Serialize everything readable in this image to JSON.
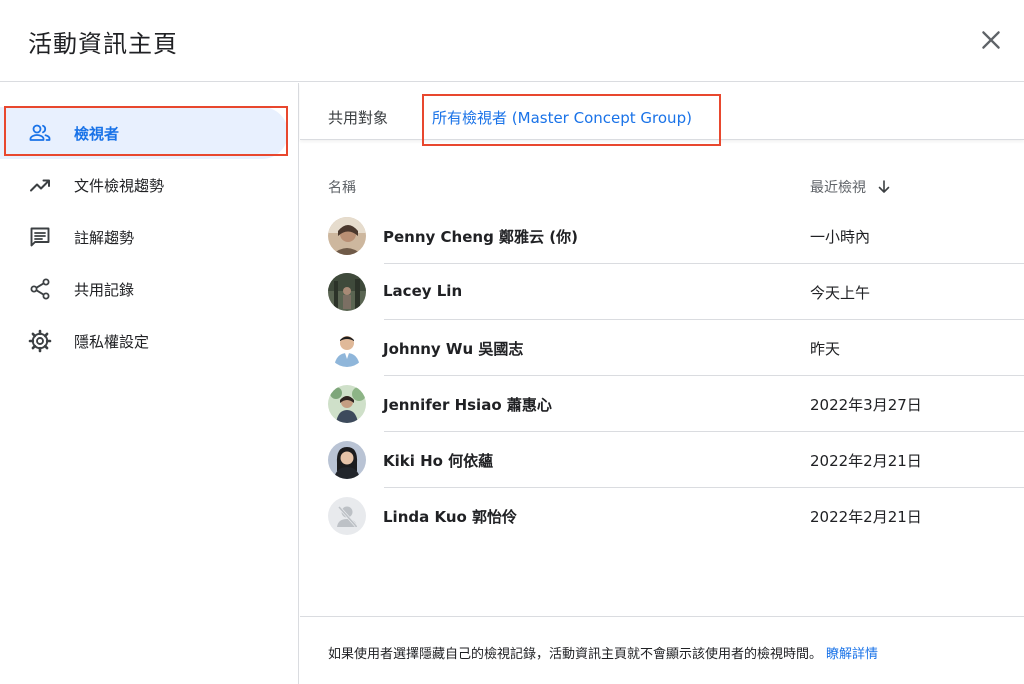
{
  "dialog": {
    "title": "活動資訊主頁"
  },
  "sidebar": {
    "items": [
      {
        "label": "檢視者",
        "icon": "people-icon",
        "active": true
      },
      {
        "label": "文件檢視趨勢",
        "icon": "trending-up-icon"
      },
      {
        "label": "註解趨勢",
        "icon": "comment-icon"
      },
      {
        "label": "共用記錄",
        "icon": "share-icon"
      },
      {
        "label": "隱私權設定",
        "icon": "gear-icon"
      }
    ]
  },
  "tabs": [
    {
      "label": "共用對象"
    },
    {
      "label": "所有檢視者 (Master Concept Group)",
      "active": true
    }
  ],
  "table": {
    "columns": {
      "name": "名稱",
      "recent": "最近檢視"
    },
    "rows": [
      {
        "name": "Penny Cheng 鄭雅云 (你)",
        "time": "一小時內"
      },
      {
        "name": "Lacey Lin",
        "time": "今天上午"
      },
      {
        "name": "Johnny Wu 吳國志",
        "time": "昨天"
      },
      {
        "name": "Jennifer Hsiao 蕭惠心",
        "time": "2022年3月27日"
      },
      {
        "name": "Kiki Ho 何依蘊",
        "time": "2022年2月21日"
      },
      {
        "name": "Linda Kuo 郭怡伶",
        "time": "2022年2月21日"
      }
    ]
  },
  "footer": {
    "text": "如果使用者選擇隱藏自己的檢視記錄，活動資訊主頁就不會顯示該使用者的檢視時間。",
    "link": "瞭解詳情"
  },
  "colors": {
    "accent": "#1a73e8",
    "active_bg": "#e8f0fe",
    "highlight": "#e8472e",
    "divider": "#dadce0"
  }
}
